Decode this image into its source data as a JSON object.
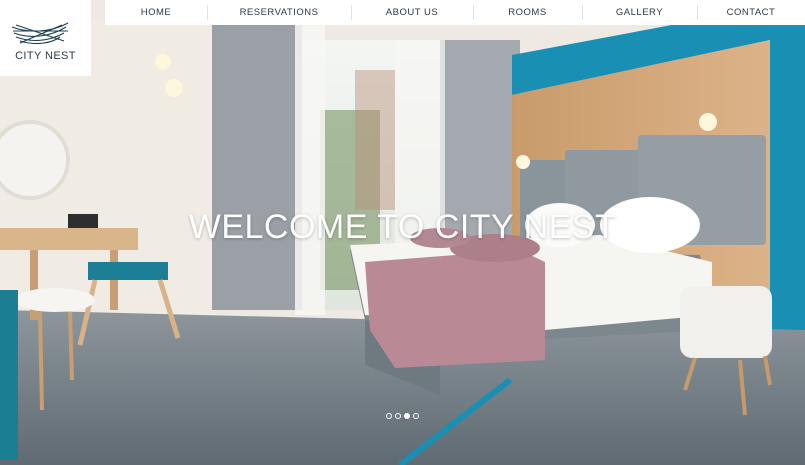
{
  "brand": {
    "name": "CITY NEST",
    "logo_icon": "nest-icon"
  },
  "nav": {
    "items": [
      "HOME",
      "RESERVATIONS",
      "ABOUT US",
      "ROOMS",
      "GALLERY",
      "CONTACT"
    ]
  },
  "hero": {
    "headline": "WELCOME TO CITY NEST",
    "slide_count": 4,
    "active_slide": 3
  },
  "colors": {
    "accent_teal": "#1a8fb4",
    "nav_bg": "#ffffff",
    "text_dark": "#2f3a42"
  }
}
